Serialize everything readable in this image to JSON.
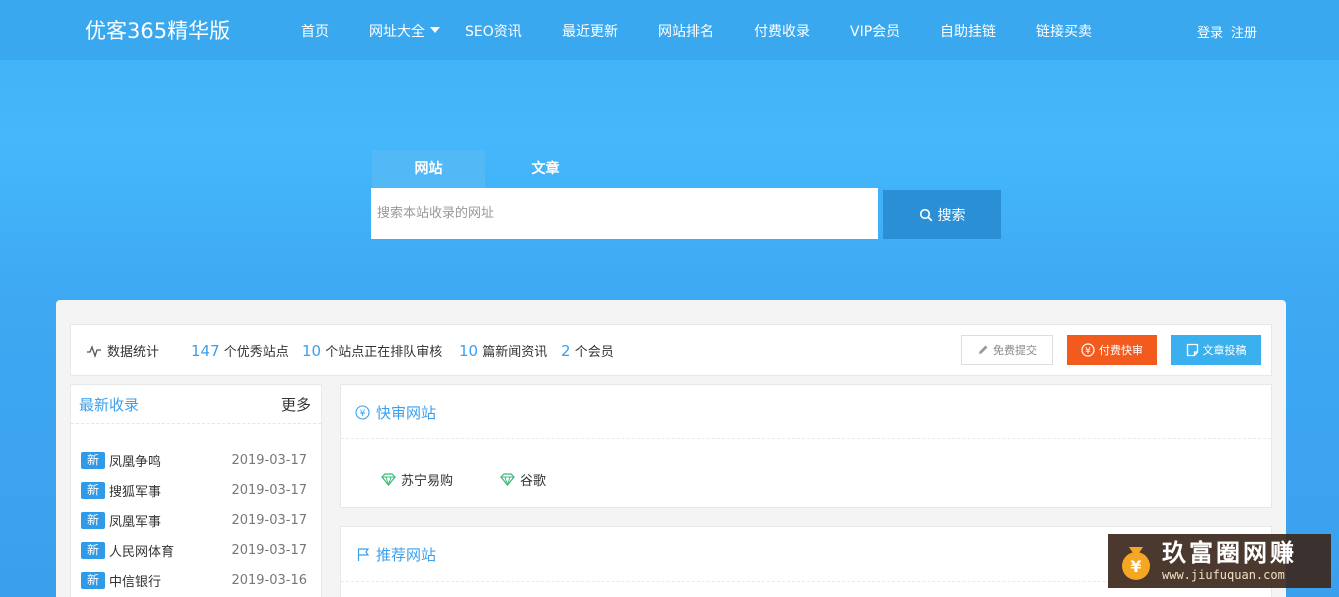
{
  "header": {
    "logo": "优客365精华版",
    "nav": [
      {
        "label": "首页"
      },
      {
        "label": "网址大全"
      },
      {
        "label": "SEO资讯"
      },
      {
        "label": "最近更新"
      },
      {
        "label": "网站排名"
      },
      {
        "label": "付费收录"
      },
      {
        "label": "VIP会员"
      },
      {
        "label": "自助挂链"
      },
      {
        "label": "链接买卖"
      }
    ],
    "login": "登录",
    "register": "注册"
  },
  "search": {
    "tabs": [
      "网站",
      "文章"
    ],
    "placeholder": "搜索本站收录的网址",
    "button": "搜索"
  },
  "stats": {
    "title": "数据统计",
    "sites_num": "147",
    "sites_text": "个优秀站点",
    "pending_num": "10",
    "pending_text": "个站点正在排队审核",
    "news_num": "10",
    "news_text": "篇新闻资讯",
    "members_num": "2",
    "members_text": "个会员",
    "btn_free": "免费提交",
    "btn_paid": "付费快审",
    "btn_article": "文章投稿"
  },
  "latest": {
    "title": "最新收录",
    "more": "更多",
    "badge": "新",
    "items": [
      {
        "name": "凤凰争鸣",
        "date": "2019-03-17"
      },
      {
        "name": "搜狐军事",
        "date": "2019-03-17"
      },
      {
        "name": "凤凰军事",
        "date": "2019-03-17"
      },
      {
        "name": "人民网体育",
        "date": "2019-03-17"
      },
      {
        "name": "中信银行",
        "date": "2019-03-16"
      }
    ]
  },
  "fast_review": {
    "title": "快审网站",
    "sites": [
      "苏宁易购",
      "谷歌"
    ]
  },
  "recommended": {
    "title": "推荐网站"
  },
  "watermark": {
    "cn": "玖富圈网赚",
    "url": "www.jiufuquan.com"
  },
  "colors": {
    "accent": "#3aa0ee",
    "paid": "#f25a1e",
    "diamond": "#3cb878"
  }
}
